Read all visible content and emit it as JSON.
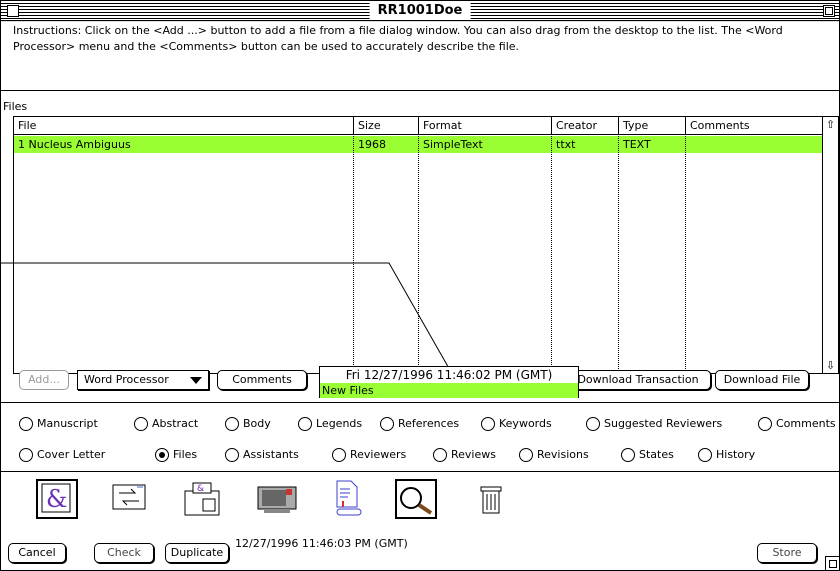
{
  "window": {
    "title": "RR1001Doe"
  },
  "instructions": "Instructions: Click on the <Add ...> button to add a file from a file dialog window.  You can also drag from the desktop to the list.  The <Word Processor> menu and the <Comments> button can be used to accurately describe the file.",
  "files_label": "Files",
  "table": {
    "columns": [
      "File",
      "Size",
      "Format",
      "Creator",
      "Type",
      "Comments"
    ],
    "rows": [
      {
        "file": "1 Nucleus Ambiguus",
        "size": "1968",
        "format": "SimpleText",
        "creator": "ttxt",
        "type": "TEXT",
        "comments": ""
      }
    ]
  },
  "buttons": {
    "add": "Add...",
    "word_processor": "Word Processor",
    "comments": "Comments",
    "download_transaction": "Download Transaction",
    "download_file": "Download File",
    "cancel": "Cancel",
    "check": "Check",
    "duplicate": "Duplicate",
    "store": "Store"
  },
  "overlay": {
    "timestamp": "Fri 12/27/1996 11:46:02 PM (GMT)",
    "status": "New Files"
  },
  "tabs_row1": [
    {
      "label": "Manuscript",
      "selected": false
    },
    {
      "label": "Abstract",
      "selected": false
    },
    {
      "label": "Body",
      "selected": false
    },
    {
      "label": "Legends",
      "selected": false
    },
    {
      "label": "References",
      "selected": false
    },
    {
      "label": "Keywords",
      "selected": false
    },
    {
      "label": "Suggested Reviewers",
      "selected": false
    },
    {
      "label": "Comments",
      "selected": false
    }
  ],
  "tabs_row2": [
    {
      "label": "Cover Letter",
      "selected": false
    },
    {
      "label": "Files",
      "selected": true
    },
    {
      "label": "Assistants",
      "selected": false
    },
    {
      "label": "Reviewers",
      "selected": false
    },
    {
      "label": "Reviews",
      "selected": false
    },
    {
      "label": "Revisions",
      "selected": false
    },
    {
      "label": "States",
      "selected": false
    },
    {
      "label": "History",
      "selected": false
    }
  ],
  "toolbar_icons": [
    "word-processor-icon",
    "transfer-icon",
    "fax-icon",
    "computer-mail-icon",
    "document-stamp-icon",
    "magnifier-icon",
    "trash-icon"
  ],
  "footer": {
    "timestamp": "12/27/1996 11:46:03 PM (GMT)"
  },
  "colors": {
    "highlight": "#99ff33"
  }
}
